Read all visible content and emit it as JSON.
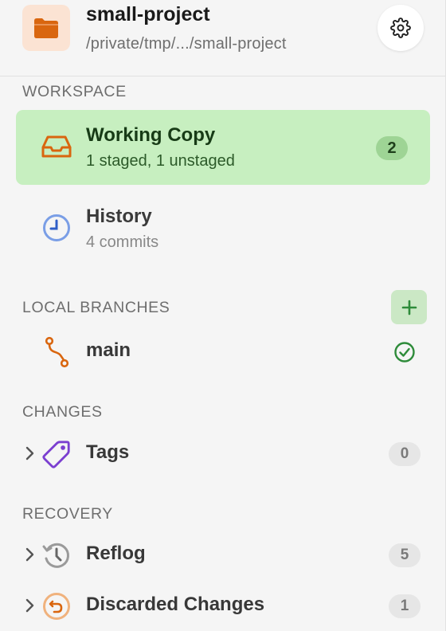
{
  "header": {
    "project_name": "small-project",
    "project_path": "/private/tmp/.../small-project",
    "project_icon": "folder-icon",
    "settings_icon": "gear-icon"
  },
  "workspace": {
    "title": "WORKSPACE",
    "items": [
      {
        "label": "Working Copy",
        "subtitle": "1 staged, 1 unstaged",
        "badge": "2",
        "icon": "inbox-tray-icon",
        "active": true
      },
      {
        "label": "History",
        "subtitle": "4 commits",
        "icon": "clock-icon",
        "active": false
      }
    ]
  },
  "local_branches": {
    "title": "LOCAL BRANCHES",
    "add_icon": "plus-icon",
    "items": [
      {
        "label": "main",
        "icon": "branch-icon",
        "status_icon": "check-circle-icon",
        "current": true
      }
    ]
  },
  "changes": {
    "title": "CHANGES",
    "items": [
      {
        "label": "Tags",
        "count": "0",
        "icon": "tag-icon"
      }
    ]
  },
  "recovery": {
    "title": "RECOVERY",
    "items": [
      {
        "label": "Reflog",
        "count": "5",
        "icon": "history-icon"
      },
      {
        "label": "Discarded Changes",
        "count": "1",
        "icon": "undo-circle-icon"
      }
    ]
  },
  "colors": {
    "accent_orange": "#d9660f",
    "active_bg": "#c7efc0",
    "active_badge": "#9ed495",
    "clock_blue": "#4a79d8",
    "tag_purple": "#7b3fd0",
    "success_green": "#2e8b3a"
  }
}
